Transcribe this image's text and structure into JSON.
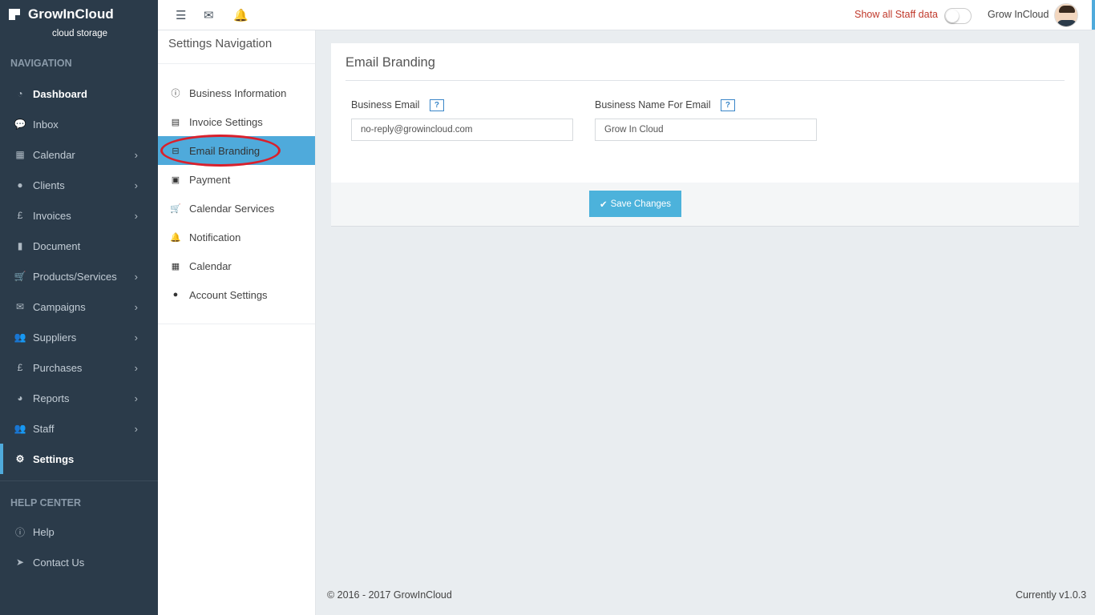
{
  "brand": {
    "name": "GrowInCloud",
    "subtitle": "cloud storage"
  },
  "sidebar": {
    "nav_heading": "NAVIGATION",
    "items": [
      {
        "label": "Dashboard",
        "icon": "dashboard-icon",
        "chevron": false
      },
      {
        "label": "Inbox",
        "icon": "chat-icon",
        "chevron": false
      },
      {
        "label": "Calendar",
        "icon": "calendar-icon",
        "chevron": true
      },
      {
        "label": "Clients",
        "icon": "user-icon",
        "chevron": true
      },
      {
        "label": "Invoices",
        "icon": "pound-icon",
        "chevron": true
      },
      {
        "label": "Document",
        "icon": "file-icon",
        "chevron": false
      },
      {
        "label": "Products/Services",
        "icon": "cart-icon",
        "chevron": true
      },
      {
        "label": "Campaigns",
        "icon": "envelope-icon",
        "chevron": true
      },
      {
        "label": "Suppliers",
        "icon": "users-icon",
        "chevron": true
      },
      {
        "label": "Purchases",
        "icon": "pound-icon",
        "chevron": true
      },
      {
        "label": "Reports",
        "icon": "pie-chart-icon",
        "chevron": true
      },
      {
        "label": "Staff",
        "icon": "users-icon",
        "chevron": true
      },
      {
        "label": "Settings",
        "icon": "gear-icon",
        "chevron": false
      }
    ],
    "help_heading": "HELP CENTER",
    "help_items": [
      {
        "label": "Help",
        "icon": "info-icon"
      },
      {
        "label": "Contact Us",
        "icon": "paper-plane-icon"
      }
    ]
  },
  "topbar": {
    "staff_toggle_label": "Show all Staff data",
    "user_name": "Grow InCloud"
  },
  "settings_nav": {
    "title": "Settings Navigation",
    "items": [
      {
        "label": "Business Information",
        "icon": "info-circle-icon"
      },
      {
        "label": "Invoice Settings",
        "icon": "file-text-icon"
      },
      {
        "label": "Email Branding",
        "icon": "inbox-icon"
      },
      {
        "label": "Payment",
        "icon": "money-icon"
      },
      {
        "label": "Calendar Services",
        "icon": "cart-icon"
      },
      {
        "label": "Notification",
        "icon": "bell-icon"
      },
      {
        "label": "Calendar",
        "icon": "calendar-icon"
      },
      {
        "label": "Account Settings",
        "icon": "user-icon"
      }
    ]
  },
  "main": {
    "card_title": "Email Branding",
    "business_email_label": "Business Email",
    "business_email_value": "no-reply@growincloud.com",
    "business_name_label": "Business Name For Email",
    "business_name_value": "Grow In Cloud",
    "help_badge": "?",
    "save_label": "Save Changes"
  },
  "footer": {
    "copyright": "© 2016 - 2017 GrowInCloud",
    "version": "Currently v1.0.3"
  },
  "colors": {
    "sidebar_bg": "#2b3b4a",
    "accent": "#4faadb",
    "save_button": "#4cb2db",
    "highlight_ring": "#d9202c",
    "toggle_label": "#c0392b"
  }
}
